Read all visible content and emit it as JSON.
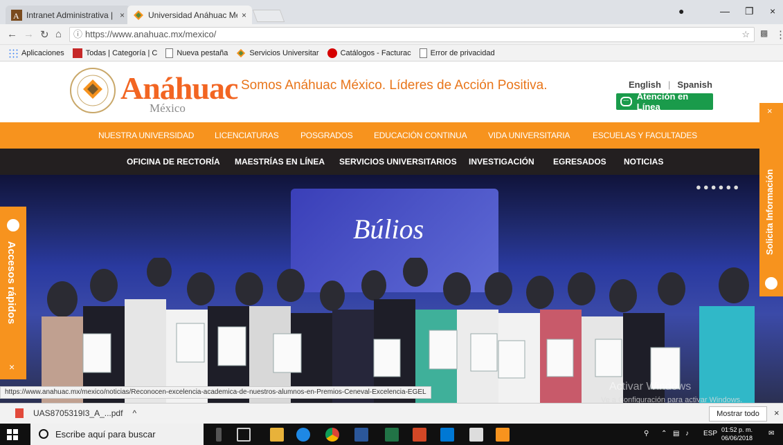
{
  "browser": {
    "tabs": [
      {
        "title": "Intranet Administrativa |",
        "active": false
      },
      {
        "title": "Universidad Anáhuac Mé",
        "active": true
      }
    ],
    "address": "https://www.anahuac.mx/mexico/",
    "bookmarks": [
      {
        "label": "Aplicaciones",
        "icon": "apps-grid-icon"
      },
      {
        "label": "Todas | Categoría | C",
        "icon": "site-favicon"
      },
      {
        "label": "Nueva pestaña",
        "icon": "page-icon"
      },
      {
        "label": "Servicios Universitar",
        "icon": "anahuac-favicon"
      },
      {
        "label": "Catálogos - Facturac",
        "icon": "red-circle-icon"
      },
      {
        "label": "Error de privacidad",
        "icon": "page-icon"
      }
    ],
    "status_url": "https://www.anahuac.mx/mexico/noticias/Reconocen-excelencia-academica-de-nuestros-alumnos-en-Premios-Ceneval-Excelencia-EGEL"
  },
  "site": {
    "logo_word": "Anáhuac",
    "logo_sub": "México",
    "tagline": "Somos Anáhuac México. Líderes de Acción Positiva.",
    "lang_english": "English",
    "lang_sep": "|",
    "lang_spanish": "Spanish",
    "chat_label": "Atención en Línea",
    "menu_primary": [
      "NUESTRA UNIVERSIDAD",
      "LICENCIATURAS",
      "POSGRADOS",
      "EDUCACIÓN CONTINUA",
      "VIDA UNIVERSITARIA",
      "ESCUELAS Y FACULTADES"
    ],
    "menu_secondary": [
      "OFICINA DE RECTORÍA",
      "MAESTRÍAS EN LÍNEA",
      "SERVICIOS UNIVERSITARIOS",
      "INVESTIGACIÓN",
      "EGRESADOS",
      "NOTICIAS"
    ],
    "hero_banner_text": "Búlios",
    "left_tab": "Accesos rápidos",
    "right_tab": "Solicita Información",
    "close_glyph": "×"
  },
  "watermark": {
    "line1": "Activar Windows",
    "line2": "Ve a Configuración para activar Windows."
  },
  "downloads": {
    "file": "UAS8705319I3_A_...pdf",
    "chevron": "^",
    "show_all": "Mostrar todo",
    "close": "×"
  },
  "taskbar": {
    "search_placeholder": "Escribe aquí para buscar",
    "lang": "ESP",
    "time": "01:52 p. m.",
    "date": "06/06/2018"
  },
  "colors": {
    "brand_orange": "#f7931e",
    "logo_orange": "#f26522",
    "menu_black": "#231f20",
    "chat_green": "#1a9b4b"
  }
}
